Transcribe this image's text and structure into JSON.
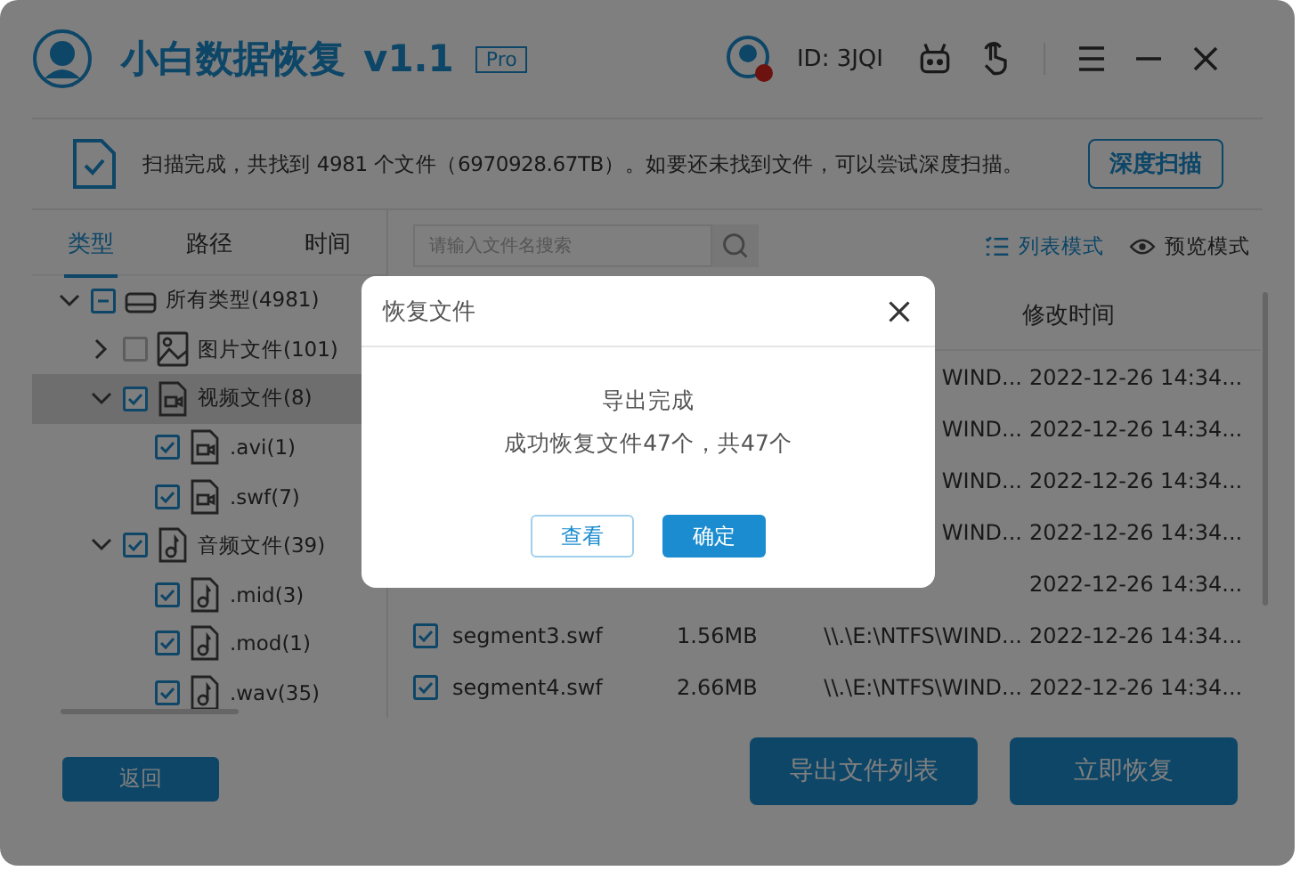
{
  "app": {
    "title": "小白数据恢复",
    "version": "v1.1",
    "edition": "Pro",
    "user_id": "ID: 3JQI"
  },
  "scan_info": {
    "message": "扫描完成，共找到 4981 个文件（6970928.67TB）。如要还未找到文件，可以尝试深度扫描。",
    "deep_scan_button": "深度扫描"
  },
  "sidebar": {
    "tabs": [
      {
        "label": "类型",
        "selected": true
      },
      {
        "label": "路径",
        "selected": false
      },
      {
        "label": "时间",
        "selected": false
      }
    ],
    "tree": [
      {
        "label": "所有类型(4981)",
        "kind": "drive",
        "checked": false,
        "partial": true,
        "expanded": true,
        "selected": false,
        "children": [
          {
            "label": "图片文件(101)",
            "kind": "image",
            "checked": false,
            "expanded": false,
            "selected": false
          },
          {
            "label": "视频文件(8)",
            "kind": "video",
            "checked": true,
            "expanded": true,
            "selected": true,
            "children": [
              {
                "label": ".avi(1)",
                "kind": "video",
                "checked": true,
                "selected": false
              },
              {
                "label": ".swf(7)",
                "kind": "video",
                "checked": true,
                "selected": false
              }
            ]
          },
          {
            "label": "音频文件(39)",
            "kind": "audio",
            "checked": true,
            "expanded": true,
            "selected": false,
            "children": [
              {
                "label": ".mid(3)",
                "kind": "audio",
                "checked": true,
                "selected": false
              },
              {
                "label": ".mod(1)",
                "kind": "audio",
                "checked": true,
                "selected": false
              },
              {
                "label": ".wav(35)",
                "kind": "audio",
                "checked": true,
                "selected": false
              }
            ]
          }
        ]
      }
    ]
  },
  "search": {
    "placeholder": "请输入文件名搜索"
  },
  "view_modes": [
    {
      "label": "列表模式",
      "kind": "list",
      "selected": true
    },
    {
      "label": "预览模式",
      "kind": "preview",
      "selected": false
    }
  ],
  "table": {
    "columns": [
      "修改时间"
    ],
    "rows": [
      {
        "path": "WIND...",
        "time": "2022-12-26 14:34..."
      },
      {
        "path": "WIND...",
        "time": "2022-12-26 14:34..."
      },
      {
        "path": "WIND...",
        "time": "2022-12-26 14:34..."
      },
      {
        "path": "WIND...",
        "time": "2022-12-26 14:34..."
      },
      {
        "time": "2022-12-26 14:34..."
      },
      {
        "checked": true,
        "name": "segment3.swf",
        "size": "1.56MB",
        "path": "\\\\.\\E:\\NTFS\\WIND...",
        "time": "2022-12-26 14:34..."
      },
      {
        "checked": true,
        "name": "segment4.swf",
        "size": "2.66MB",
        "path": "\\\\.\\E:\\NTFS\\WIND...",
        "time": "2022-12-26 14:34..."
      }
    ]
  },
  "buttons": {
    "back": "返回",
    "export_list": "导出文件列表",
    "recover": "立即恢复"
  },
  "dialog": {
    "title": "恢复文件",
    "heading": "导出完成",
    "message": "成功恢复文件47个，共47个",
    "view_button": "查看",
    "ok_button": "确定"
  }
}
